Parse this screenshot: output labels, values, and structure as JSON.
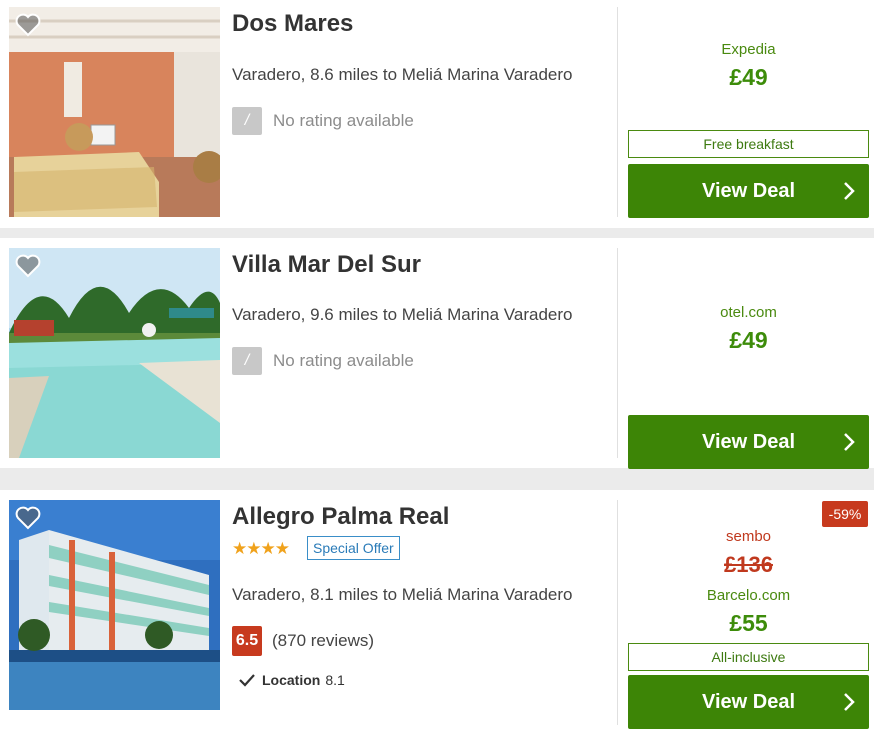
{
  "hotels": [
    {
      "name": "Dos Mares",
      "location": "Varadero, 8.6 miles to Meliá Marina Varadero",
      "rating_box": "/",
      "rating_text": "No rating available",
      "provider": "Expedia",
      "price": "£49",
      "tag": "Free breakfast",
      "cta": "View Deal",
      "image_icon": "hotel-room-photo"
    },
    {
      "name": "Villa Mar Del Sur",
      "location": "Varadero, 9.6 miles to Meliá Marina Varadero",
      "rating_box": "/",
      "rating_text": "No rating available",
      "provider": "otel.com",
      "price": "£49",
      "cta": "View Deal",
      "image_icon": "pool-photo"
    },
    {
      "name": "Allegro Palma Real",
      "stars": "★★★★",
      "star_count": 4,
      "special_offer": "Special Offer",
      "location": "Varadero, 8.1 miles to Meliá Marina Varadero",
      "score": "6.5",
      "reviews": "(870 reviews)",
      "sub_rating_label": "Location",
      "sub_rating_value": "8.1",
      "discount": "-59%",
      "old_provider": "sembo",
      "old_price": "£136",
      "provider": "Barcelo.com",
      "price": "£55",
      "tag": "All-inclusive",
      "cta": "View Deal",
      "image_icon": "hotel-building-photo"
    }
  ],
  "colors": {
    "deal_button": "#3d8506",
    "price_green": "#3d8c0a",
    "score_red": "#c73a1e",
    "star_orange": "#f0a21c",
    "special_blue": "#2a7bb8"
  }
}
